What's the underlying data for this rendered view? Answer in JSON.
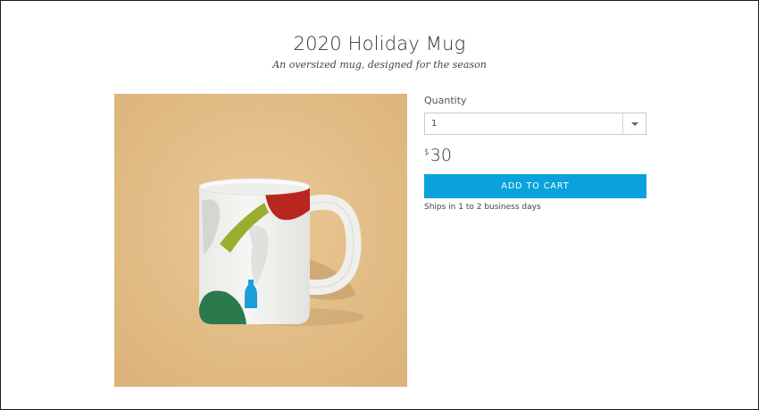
{
  "product": {
    "title": "2020 Holiday Mug",
    "subtitle": "An oversized mug, designed for the season",
    "image": {
      "icon": "mug-photo",
      "background_color": "#e6c28e",
      "mug_color": "#f2f2f0",
      "brush_colors": [
        "#b8261e",
        "#9aae2e",
        "#2b7a4e",
        "#c8c8c8"
      ],
      "logo_color": "#1e9ed6"
    }
  },
  "purchase": {
    "quantity_label": "Quantity",
    "quantity_value": "1",
    "quantity_dropdown_icon": "chevron-down-icon",
    "currency_symbol": "$",
    "price": "30",
    "add_to_cart_label": "ADD TO CART",
    "button_color": "#0aa2dc",
    "shipping_note": "Ships in 1 to 2 business days"
  }
}
